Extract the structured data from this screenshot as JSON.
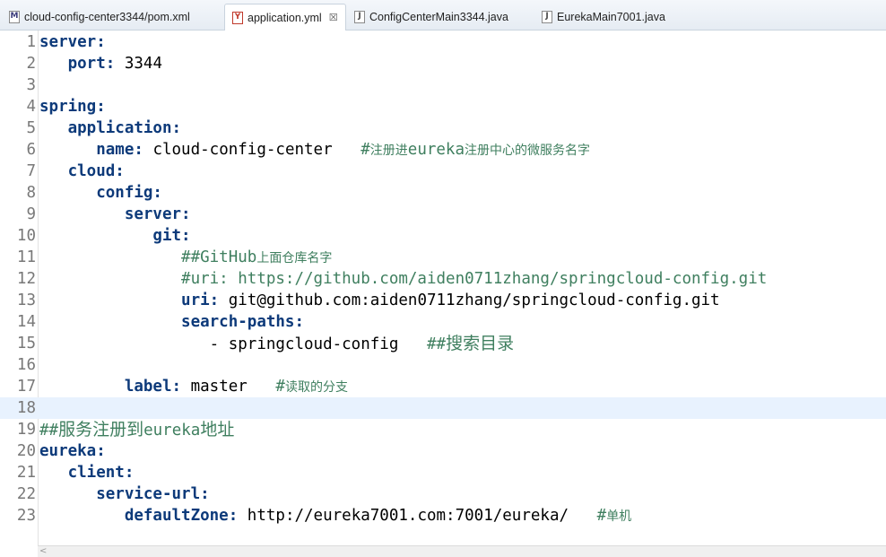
{
  "tabs": [
    {
      "label": "cloud-config-center3344/pom.xml",
      "icon": "maven-file-icon",
      "glyph": "M",
      "active": false
    },
    {
      "label": "application.yml",
      "icon": "yaml-file-icon",
      "glyph": "Y",
      "active": true,
      "close": "☒"
    },
    {
      "label": "ConfigCenterMain3344.java",
      "icon": "java-file-icon",
      "glyph": "J",
      "active": false
    },
    {
      "label": "EurekaMain7001.java",
      "icon": "java-file-icon",
      "glyph": "J",
      "active": false
    }
  ],
  "editor": {
    "current_line": 18,
    "lines": [
      {
        "n": "1",
        "key": "server:",
        "val": "",
        "cmt": ""
      },
      {
        "n": "2",
        "key": "   port:",
        "val": " 3344",
        "cmt": ""
      },
      {
        "n": "3",
        "key": "",
        "val": "",
        "cmt": ""
      },
      {
        "n": "4",
        "key": "spring:",
        "val": "",
        "cmt": ""
      },
      {
        "n": "5",
        "key": "   application:",
        "val": "",
        "cmt": ""
      },
      {
        "n": "6",
        "key": "      name:",
        "val": " cloud-config-center",
        "cmt": "#注册进eureka注册中心的微服务名字"
      },
      {
        "n": "7",
        "key": "   cloud:",
        "val": "",
        "cmt": ""
      },
      {
        "n": "8",
        "key": "      config:",
        "val": "",
        "cmt": ""
      },
      {
        "n": "9",
        "key": "         server:",
        "val": "",
        "cmt": ""
      },
      {
        "n": "10",
        "key": "            git:",
        "val": "",
        "cmt": ""
      },
      {
        "n": "11",
        "key": "",
        "val": "",
        "cmt": "               ##GitHub上面仓库名字"
      },
      {
        "n": "12",
        "key": "",
        "val": "",
        "cmt": "               #uri: https://github.com/aiden0711zhang/springcloud-config.git"
      },
      {
        "n": "13",
        "key": "               uri:",
        "val": " git@github.com:aiden0711zhang/springcloud-config.git",
        "cmt": ""
      },
      {
        "n": "14",
        "key": "               search-paths:",
        "val": "",
        "cmt": ""
      },
      {
        "n": "15",
        "key": "",
        "val": "                  - springcloud-config",
        "cmt": "##搜索目录"
      },
      {
        "n": "16",
        "key": "",
        "val": "",
        "cmt": ""
      },
      {
        "n": "17",
        "key": "         label:",
        "val": " master",
        "cmt": "#读取的分支"
      },
      {
        "n": "18",
        "key": "",
        "val": "",
        "cmt": ""
      },
      {
        "n": "19",
        "key": "",
        "val": "",
        "cmt": "##服务注册到eureka地址"
      },
      {
        "n": "20",
        "key": "eureka:",
        "val": "",
        "cmt": ""
      },
      {
        "n": "21",
        "key": "   client:",
        "val": "",
        "cmt": ""
      },
      {
        "n": "22",
        "key": "      service-url:",
        "val": "",
        "cmt": ""
      },
      {
        "n": "23",
        "key": "         defaultZone:",
        "val": " http://eureka7001.com:7001/eureka/",
        "cmt": "#单机"
      }
    ]
  },
  "scrollbar": {
    "left_arrow": "<"
  }
}
